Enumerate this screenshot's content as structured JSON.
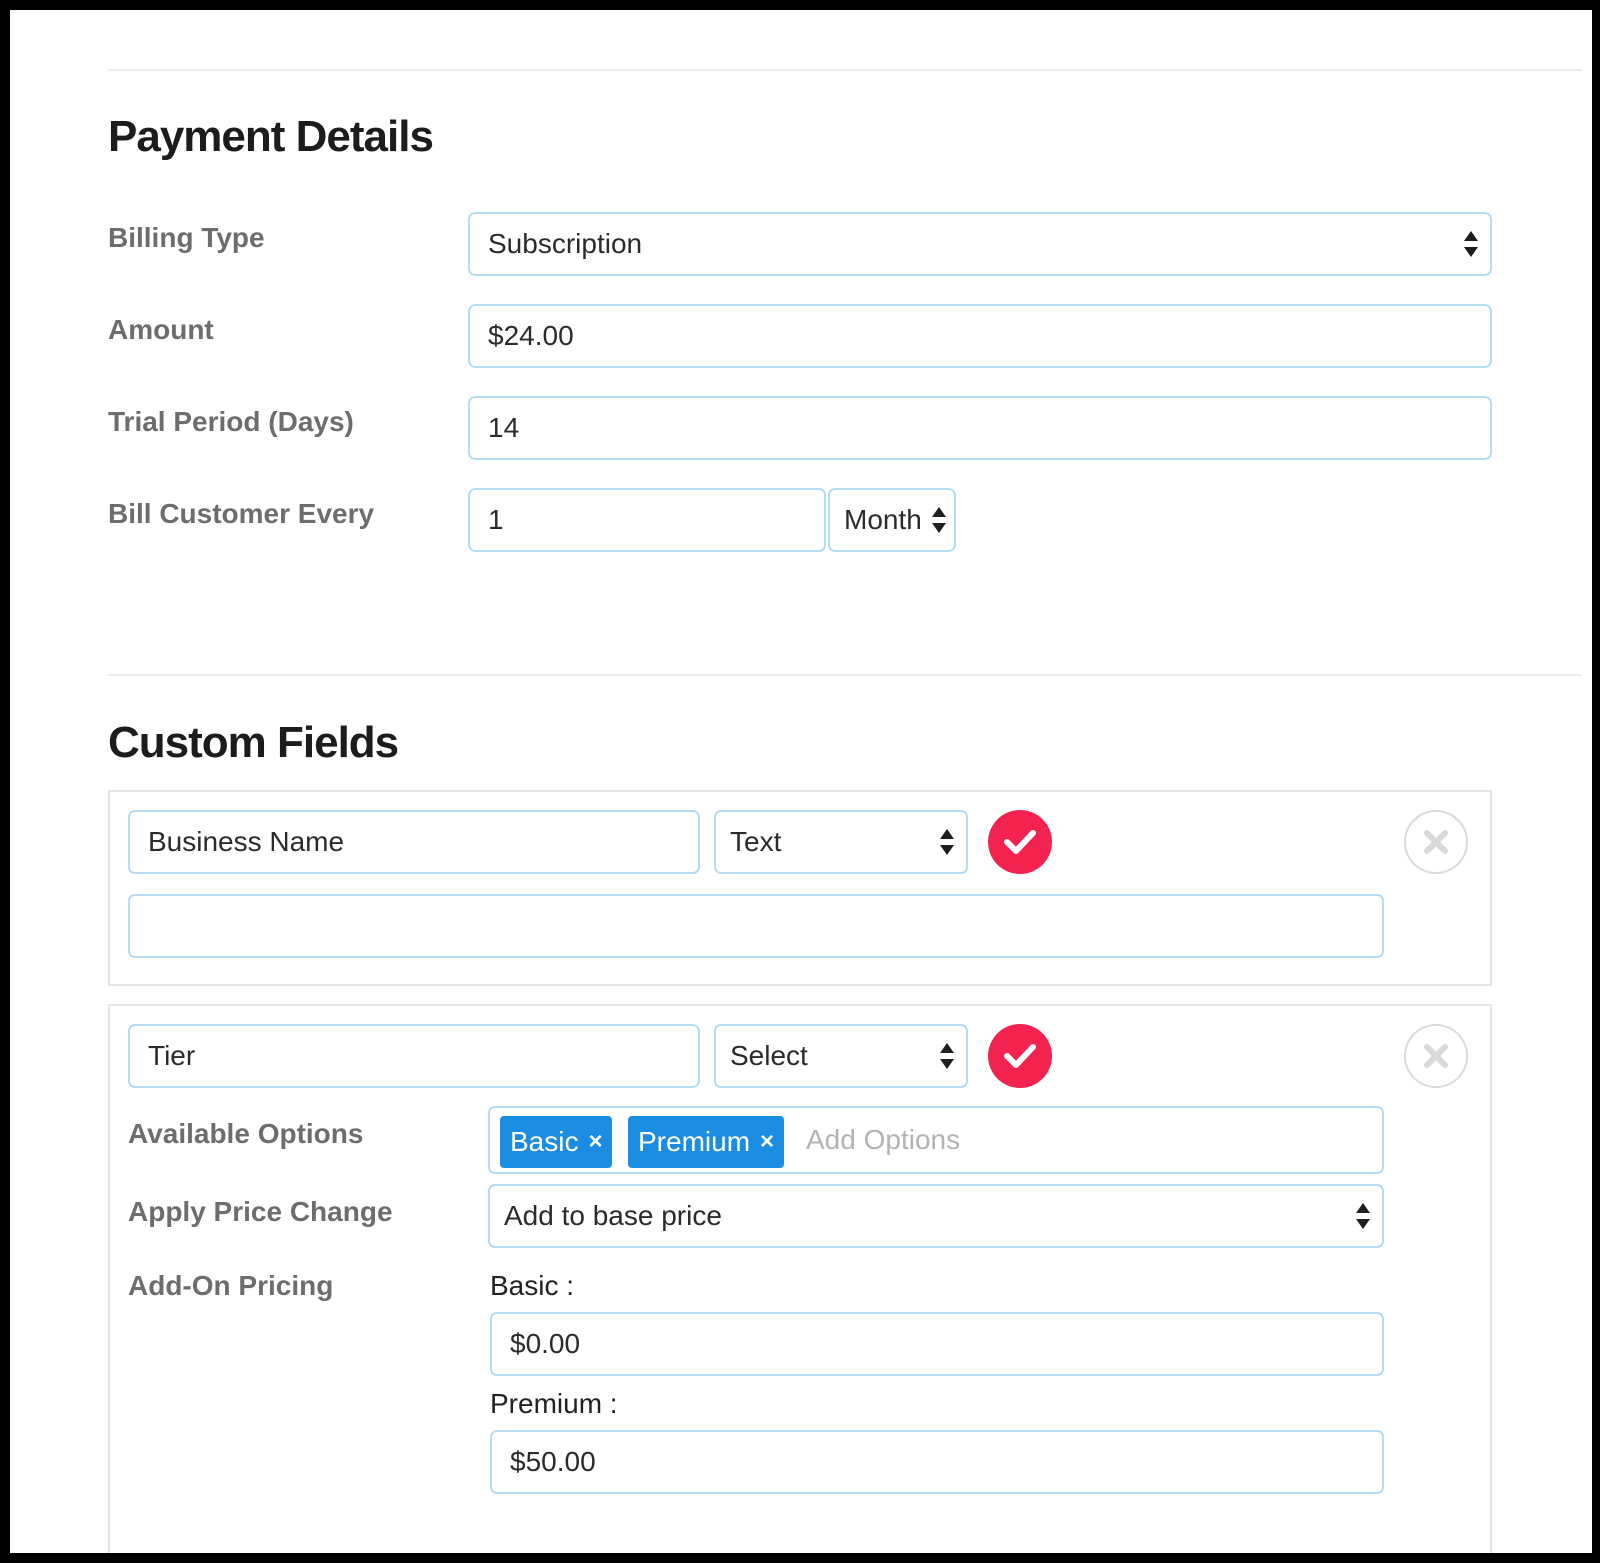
{
  "payment": {
    "title": "Payment Details",
    "billing_type": {
      "label": "Billing Type",
      "value": "Subscription"
    },
    "amount": {
      "label": "Amount",
      "value": "$24.00"
    },
    "trial": {
      "label": "Trial Period (Days)",
      "value": "14"
    },
    "bill_every": {
      "label": "Bill Customer Every",
      "value": "1",
      "unit": "Month"
    }
  },
  "custom_fields": {
    "title": "Custom Fields",
    "fields": [
      {
        "name": "Business Name",
        "type": "Text",
        "extra_value": ""
      },
      {
        "name": "Tier",
        "type": "Select",
        "available_options": {
          "label": "Available Options",
          "tags": [
            "Basic",
            "Premium"
          ],
          "placeholder": "Add Options",
          "remove_glyph": "×"
        },
        "apply_price_change": {
          "label": "Apply Price Change",
          "value": "Add to base price"
        },
        "addon_pricing": {
          "label": "Add-On Pricing",
          "items": [
            {
              "label": "Basic :",
              "value": "$0.00"
            },
            {
              "label": "Premium :",
              "value": "$50.00"
            }
          ]
        }
      }
    ]
  },
  "icons": {
    "check": "check-icon",
    "remove": "close-icon",
    "spinner": "select-arrows-icon"
  },
  "colors": {
    "accent_red": "#f3224f",
    "tag_blue": "#1a8de3",
    "input_border": "#b5dcf2",
    "label_gray": "#6d6d6d"
  }
}
